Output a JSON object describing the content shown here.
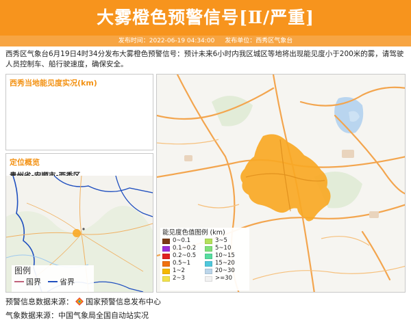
{
  "header": {
    "title": "大雾橙色预警信号[Ⅱ/严重]"
  },
  "subbar": {
    "time_label": "发布时间：2022-06-19 04:34:00",
    "unit_label": "发布单位：西秀区气象台"
  },
  "description": "西秀区气象台6月19日4时34分发布大雾橙色预警信号：预计未来6小时内我区城区等地将出现能见度小于200米的雾，请驾驶人员控制车、船行驶速度，确保安全。",
  "visibility_panel": {
    "title": "西秀当地能见度实况(km)"
  },
  "location_panel": {
    "title": "定位概览",
    "subtitle": "贵州省-安顺市-西秀区",
    "legend": {
      "title": "图例",
      "items": [
        {
          "label": "国界",
          "color": "#c0627a"
        },
        {
          "label": "省界",
          "color": "#1f4fbf"
        }
      ]
    }
  },
  "vis_legend": {
    "title": "能见度色值图例 (km)",
    "items": [
      {
        "label": "0~0.1",
        "color": "#7b3a14"
      },
      {
        "label": "3~5",
        "color": "#b3e05a"
      },
      {
        "label": "0.1~0.2",
        "color": "#9b30d8"
      },
      {
        "label": "5~10",
        "color": "#7fe07a"
      },
      {
        "label": "0.2~0.5",
        "color": "#e02020"
      },
      {
        "label": "10~15",
        "color": "#56dc9f"
      },
      {
        "label": "0.5~1",
        "color": "#f07010"
      },
      {
        "label": "15~20",
        "color": "#4fc8dc"
      },
      {
        "label": "1~2",
        "color": "#f5b800"
      },
      {
        "label": "20~30",
        "color": "#bcd6ea"
      },
      {
        "label": "2~3",
        "color": "#f2e24a"
      },
      {
        "label": ">=30",
        "color": "#f2f2f2"
      }
    ]
  },
  "footer": {
    "source1_label": "预警信息数据来源：",
    "source1_value": "国家预警信息发布中心",
    "source2": "气象数据来源：中国气象局全国自动站实况"
  },
  "colors": {
    "brand": "#f7941d",
    "warning_area": "#f9a825"
  }
}
